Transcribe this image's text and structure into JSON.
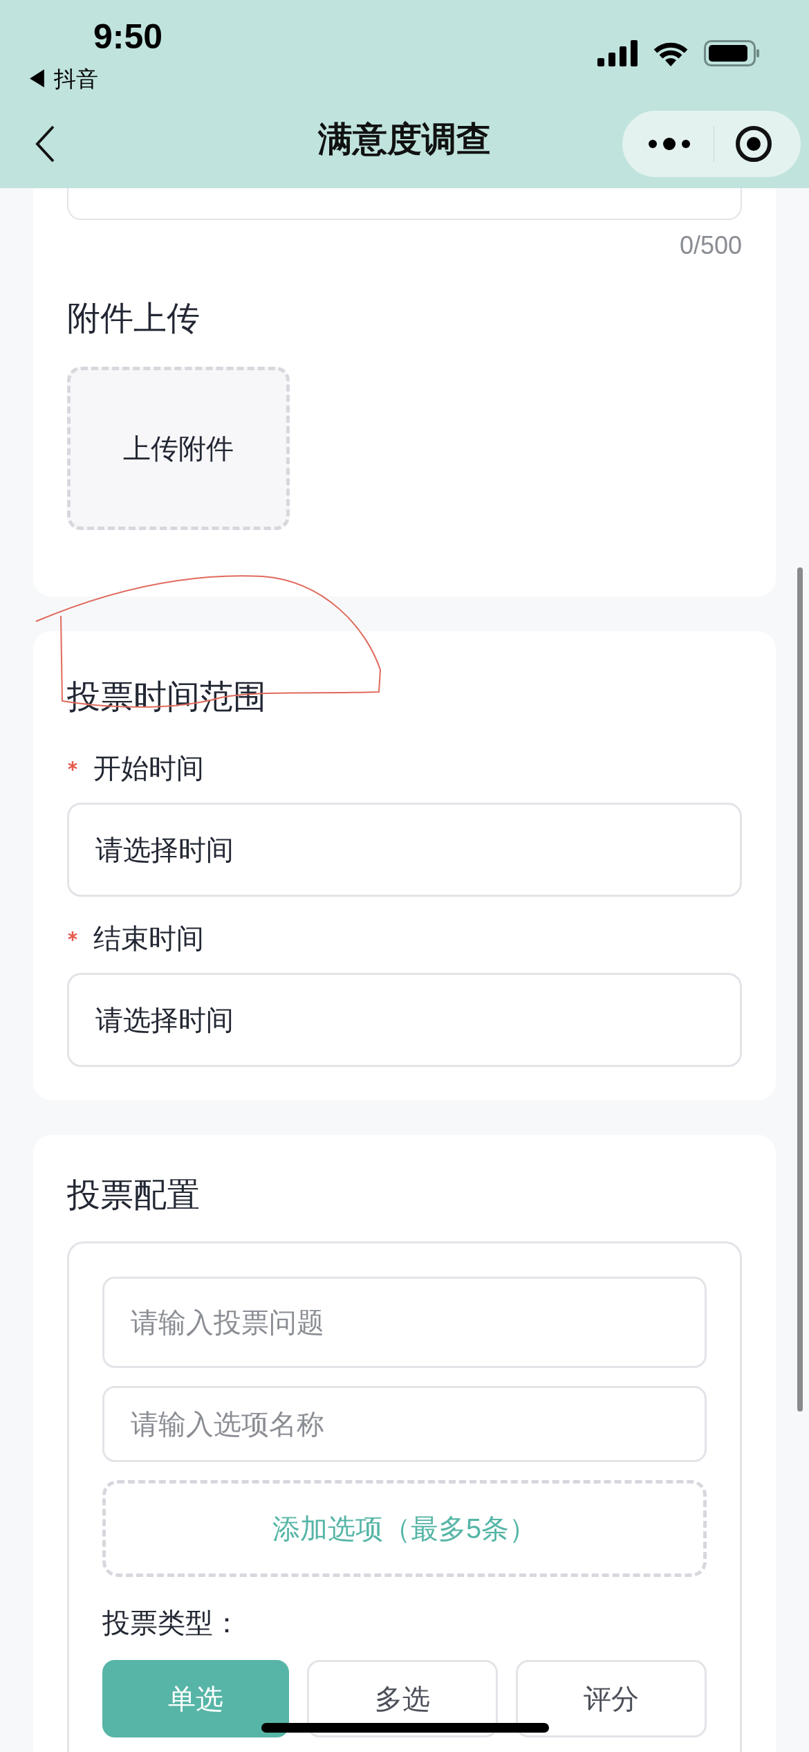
{
  "status_bar": {
    "time": "9:50",
    "back_app": "◀ 抖音"
  },
  "nav": {
    "title": "满意度调查"
  },
  "description": {
    "counter": "0/500"
  },
  "attachment": {
    "title": "附件上传",
    "upload_label": "上传附件"
  },
  "time_range": {
    "title": "投票时间范围",
    "fields": [
      {
        "label": "开始时间",
        "required": true,
        "placeholder": "请选择时间"
      },
      {
        "label": "结束时间",
        "required": true,
        "placeholder": "请选择时间"
      }
    ]
  },
  "vote_config": {
    "title": "投票配置",
    "question_placeholder": "请输入投票问题",
    "option_placeholder": "请输入选项名称",
    "add_option": "添加选项（最多5条）",
    "type_label": "投票类型：",
    "types": [
      {
        "label": "单选",
        "selected": true
      },
      {
        "label": "多选",
        "selected": false
      },
      {
        "label": "评分",
        "selected": false
      }
    ]
  }
}
